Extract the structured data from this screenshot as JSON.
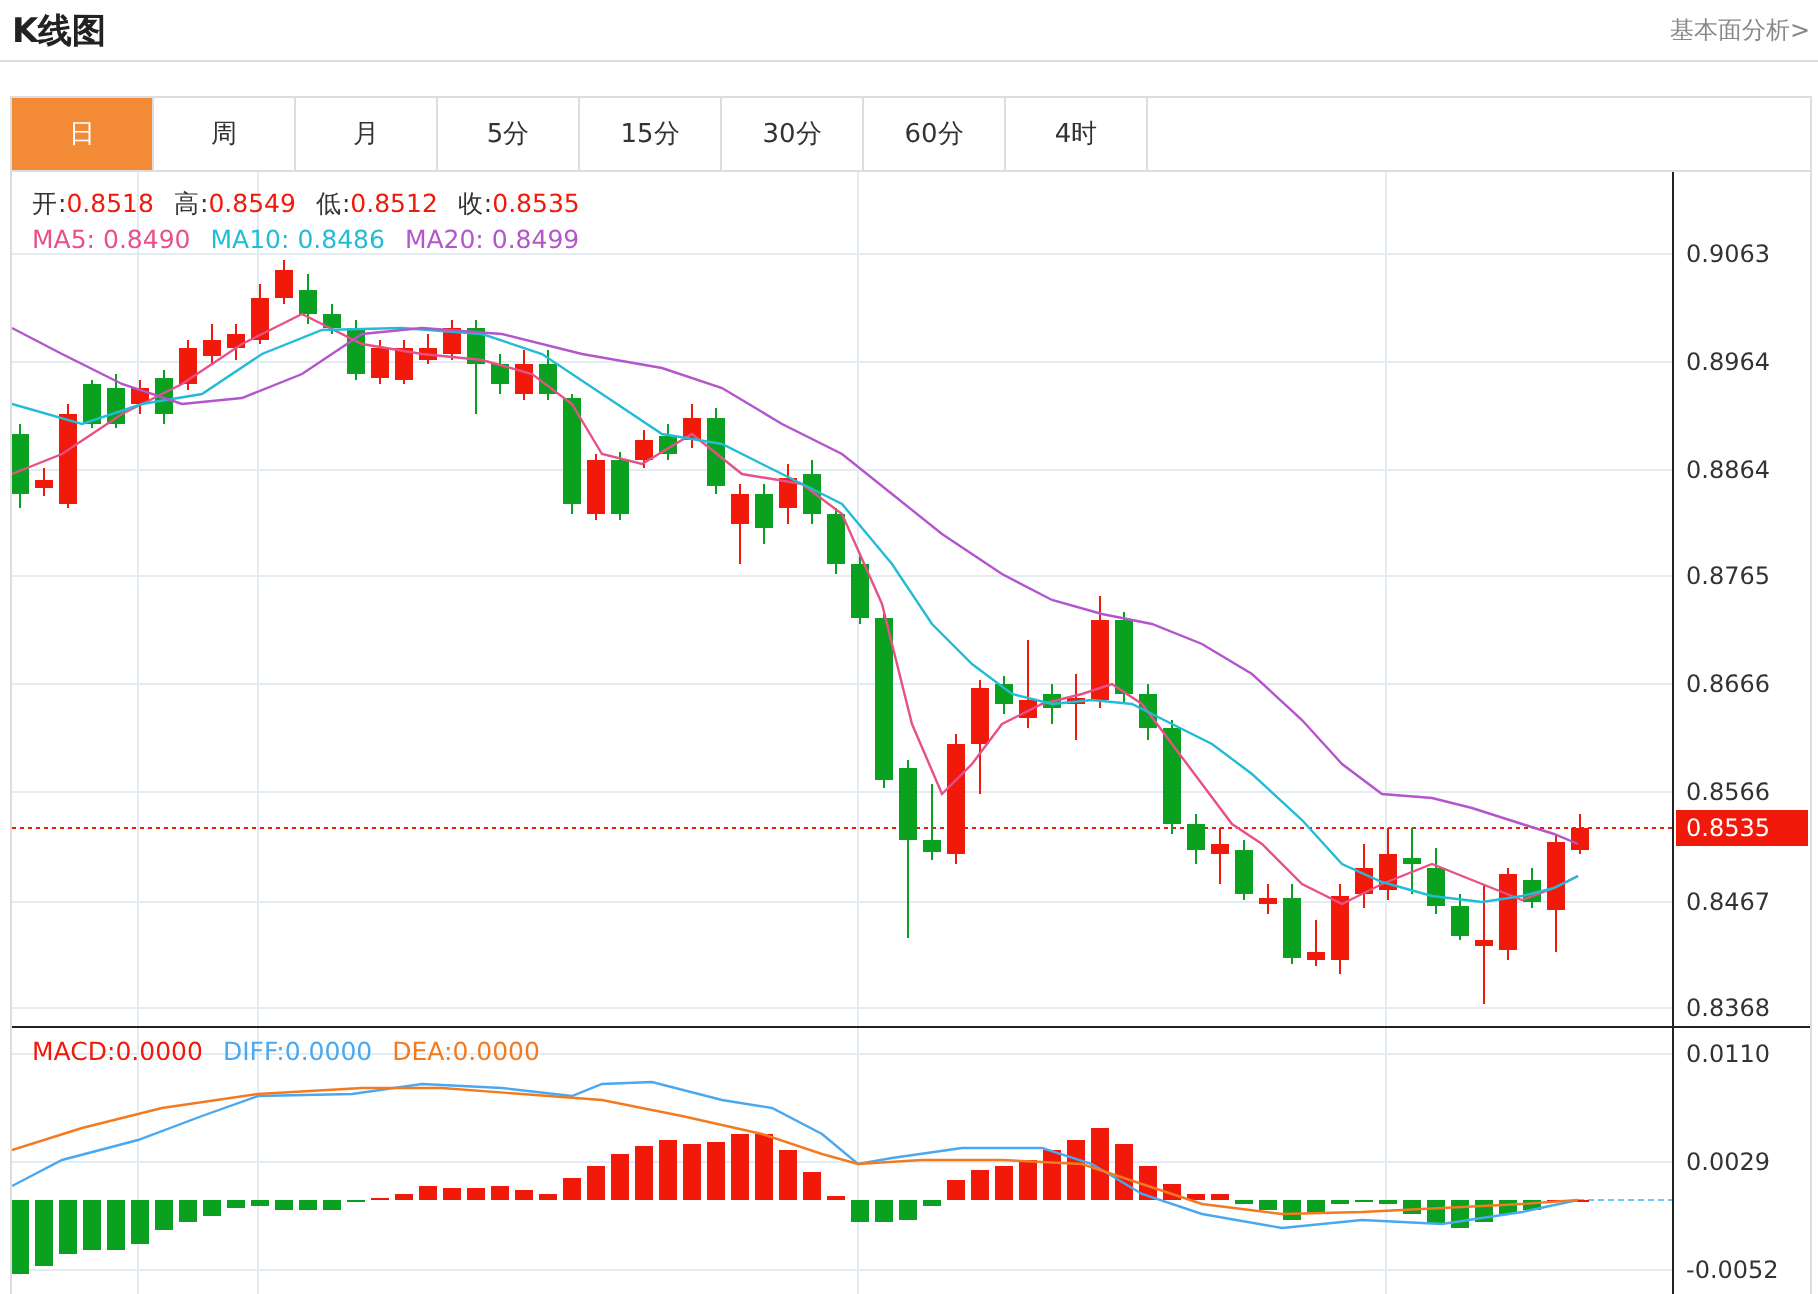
{
  "header": {
    "title": "K线图",
    "link": "基本面分析>"
  },
  "tabs": [
    {
      "label": "日",
      "selected": true
    },
    {
      "label": "周",
      "selected": false
    },
    {
      "label": "月",
      "selected": false
    },
    {
      "label": "5分",
      "selected": false
    },
    {
      "label": "15分",
      "selected": false
    },
    {
      "label": "30分",
      "selected": false
    },
    {
      "label": "60分",
      "selected": false
    },
    {
      "label": "4时",
      "selected": false
    }
  ],
  "ohlc": [
    {
      "label": "开:",
      "value": "0.8518"
    },
    {
      "label": "高:",
      "value": "0.8549"
    },
    {
      "label": "低:",
      "value": "0.8512"
    },
    {
      "label": "收:",
      "value": "0.8535"
    }
  ],
  "moving_averages": [
    {
      "label": "MA5:",
      "value": "0.8490",
      "color": "#e8508a"
    },
    {
      "label": "MA10:",
      "value": "0.8486",
      "color": "#22bcd6"
    },
    {
      "label": "MA20:",
      "value": "0.8499",
      "color": "#b455cc"
    }
  ],
  "price_axis": {
    "ticks": [
      "0.9063",
      "0.8964",
      "0.8864",
      "0.8765",
      "0.8666",
      "0.8566",
      "0.8467",
      "0.8368"
    ],
    "current": "0.8535"
  },
  "macd_legend": [
    {
      "label": "MACD:",
      "value": "0.0000",
      "color": "#f0190a"
    },
    {
      "label": "DIFF:",
      "value": "0.0000",
      "color": "#4aa8f0"
    },
    {
      "label": "DEA:",
      "value": "0.0000",
      "color": "#f47a20"
    }
  ],
  "macd_axis": {
    "ticks": [
      "0.0110",
      "0.0029",
      "-0.0052"
    ]
  }
}
